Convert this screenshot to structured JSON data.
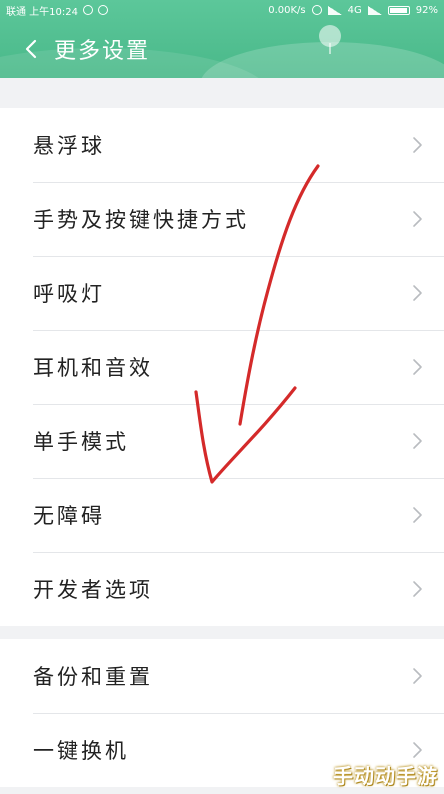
{
  "status_bar": {
    "left_text": "联通 上午10:24",
    "battery_pct": "92%",
    "network_text": "0.00K/s",
    "carrier_text": "4G"
  },
  "header": {
    "title": "更多设置",
    "back_icon": "chevron-left-icon"
  },
  "groups": [
    {
      "items": [
        {
          "label": "悬浮球"
        },
        {
          "label": "手势及按键快捷方式"
        },
        {
          "label": "呼吸灯"
        },
        {
          "label": "耳机和音效"
        },
        {
          "label": "单手模式"
        },
        {
          "label": "无障碍"
        },
        {
          "label": "开发者选项"
        }
      ]
    },
    {
      "items": [
        {
          "label": "备份和重置"
        },
        {
          "label": "一键换机"
        }
      ]
    }
  ],
  "row_icon": "chevron-right-icon",
  "annotation": {
    "kind": "red hand-drawn arrow",
    "color": "#d42a2a",
    "icon": "arrow-annotation-icon"
  },
  "watermark": {
    "text": "手动动手游"
  },
  "colors": {
    "header_green": "#52bf91",
    "page_bg": "#f1f2f4",
    "divider": "#e4e6e9",
    "chevron": "#b9bcc0"
  }
}
